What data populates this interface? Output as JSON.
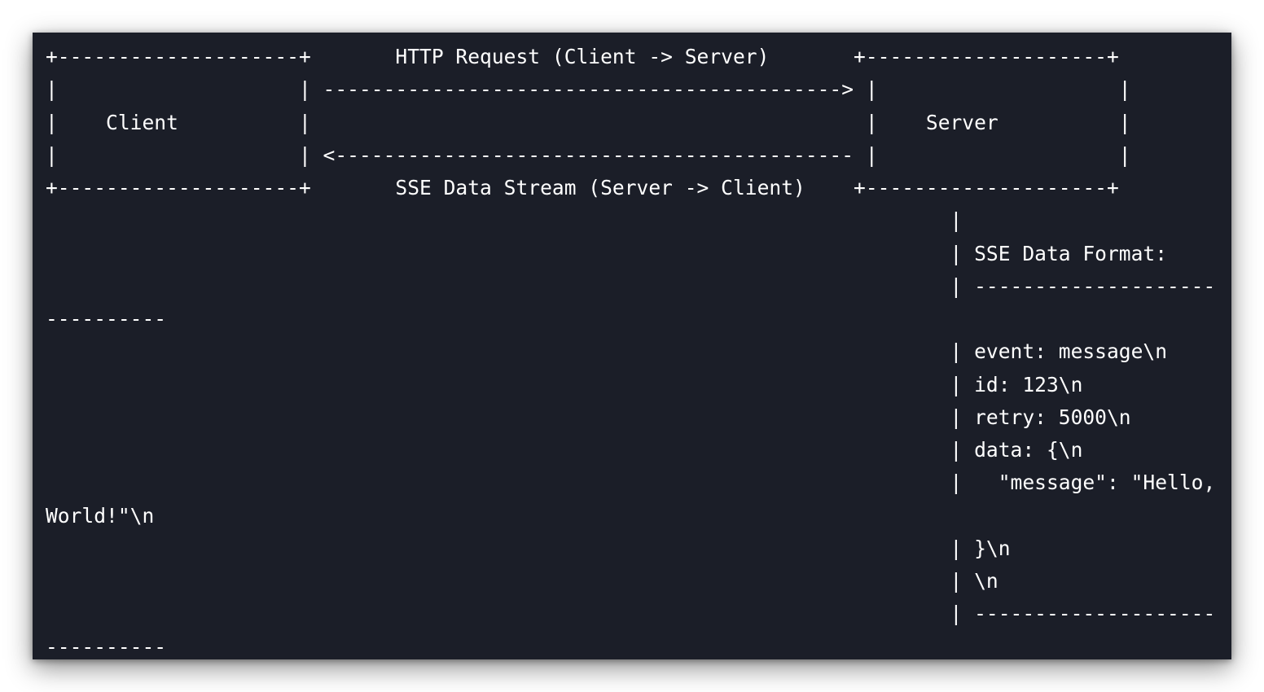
{
  "diagram": {
    "lines": [
      "+--------------------+       HTTP Request (Client -> Server)       +--------------------+",
      "|                    | -------------------------------------------> |                    |",
      "|    Client          |                                              |    Server          |",
      "|                    | <------------------------------------------- |                    |",
      "+--------------------+       SSE Data Stream (Server -> Client)    +--------------------+",
      "                                                                           |",
      "                                                                           | SSE Data Format:",
      "                                                                           | --------------------",
      "----------",
      "                                                                           | event: message\\n",
      "                                                                           | id: 123\\n",
      "                                                                           | retry: 5000\\n",
      "                                                                           | data: {\\n",
      "                                                                           |   \"message\": \"Hello,",
      "World!\"\\n",
      "                                                                           | }\\n",
      "                                                                           | \\n",
      "                                                                           | --------------------",
      "----------"
    ]
  }
}
